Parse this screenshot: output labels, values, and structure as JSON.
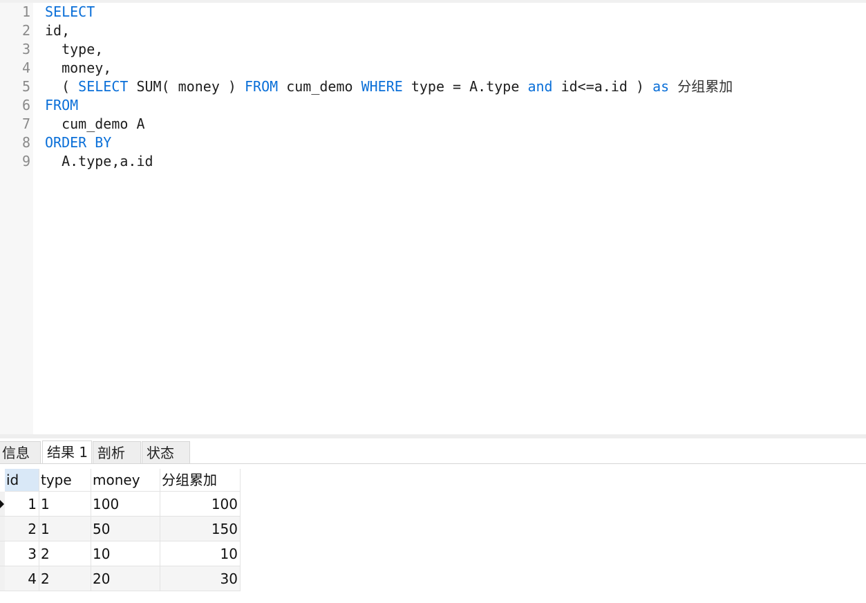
{
  "editor": {
    "line_numbers": [
      "1",
      "2",
      "3",
      "4",
      "5",
      "6",
      "7",
      "8",
      "9"
    ],
    "lines": [
      [
        {
          "t": "SELECT",
          "k": true
        }
      ],
      [
        {
          "t": "id,",
          "k": false
        }
      ],
      [
        {
          "t": "  type,",
          "k": false
        }
      ],
      [
        {
          "t": "  money,",
          "k": false
        }
      ],
      [
        {
          "t": "  ( ",
          "k": false
        },
        {
          "t": "SELECT",
          "k": true
        },
        {
          "t": " SUM( money ) ",
          "k": false
        },
        {
          "t": "FROM",
          "k": true
        },
        {
          "t": " cum_demo ",
          "k": false
        },
        {
          "t": "WHERE",
          "k": true
        },
        {
          "t": " type = A.type ",
          "k": false
        },
        {
          "t": "and",
          "k": true
        },
        {
          "t": " id<=a.id ) ",
          "k": false
        },
        {
          "t": "as",
          "k": true
        },
        {
          "t": " ",
          "k": false
        },
        {
          "t": "分组累加",
          "k": false,
          "cjk": true
        }
      ],
      [
        {
          "t": "FROM",
          "k": true
        }
      ],
      [
        {
          "t": "  cum_demo A",
          "k": false
        }
      ],
      [
        {
          "t": "ORDER BY",
          "k": true
        }
      ],
      [
        {
          "t": "  A.type,a.id",
          "k": false
        }
      ]
    ]
  },
  "tabs": [
    {
      "label": "信息",
      "active": false
    },
    {
      "label": "结果 1",
      "active": true
    },
    {
      "label": "剖析",
      "active": false
    },
    {
      "label": "状态",
      "active": false
    }
  ],
  "result": {
    "columns": [
      "id",
      "type",
      "money",
      "分组累加"
    ],
    "rows": [
      [
        "1",
        "1",
        "100",
        "100"
      ],
      [
        "2",
        "1",
        "50",
        "150"
      ],
      [
        "3",
        "2",
        "10",
        "10"
      ],
      [
        "4",
        "2",
        "20",
        "30"
      ]
    ],
    "current_row_icon": "row-cursor-icon"
  },
  "colors": {
    "keyword": "#0a6fd8",
    "header_selected": "#d9e8f7"
  }
}
